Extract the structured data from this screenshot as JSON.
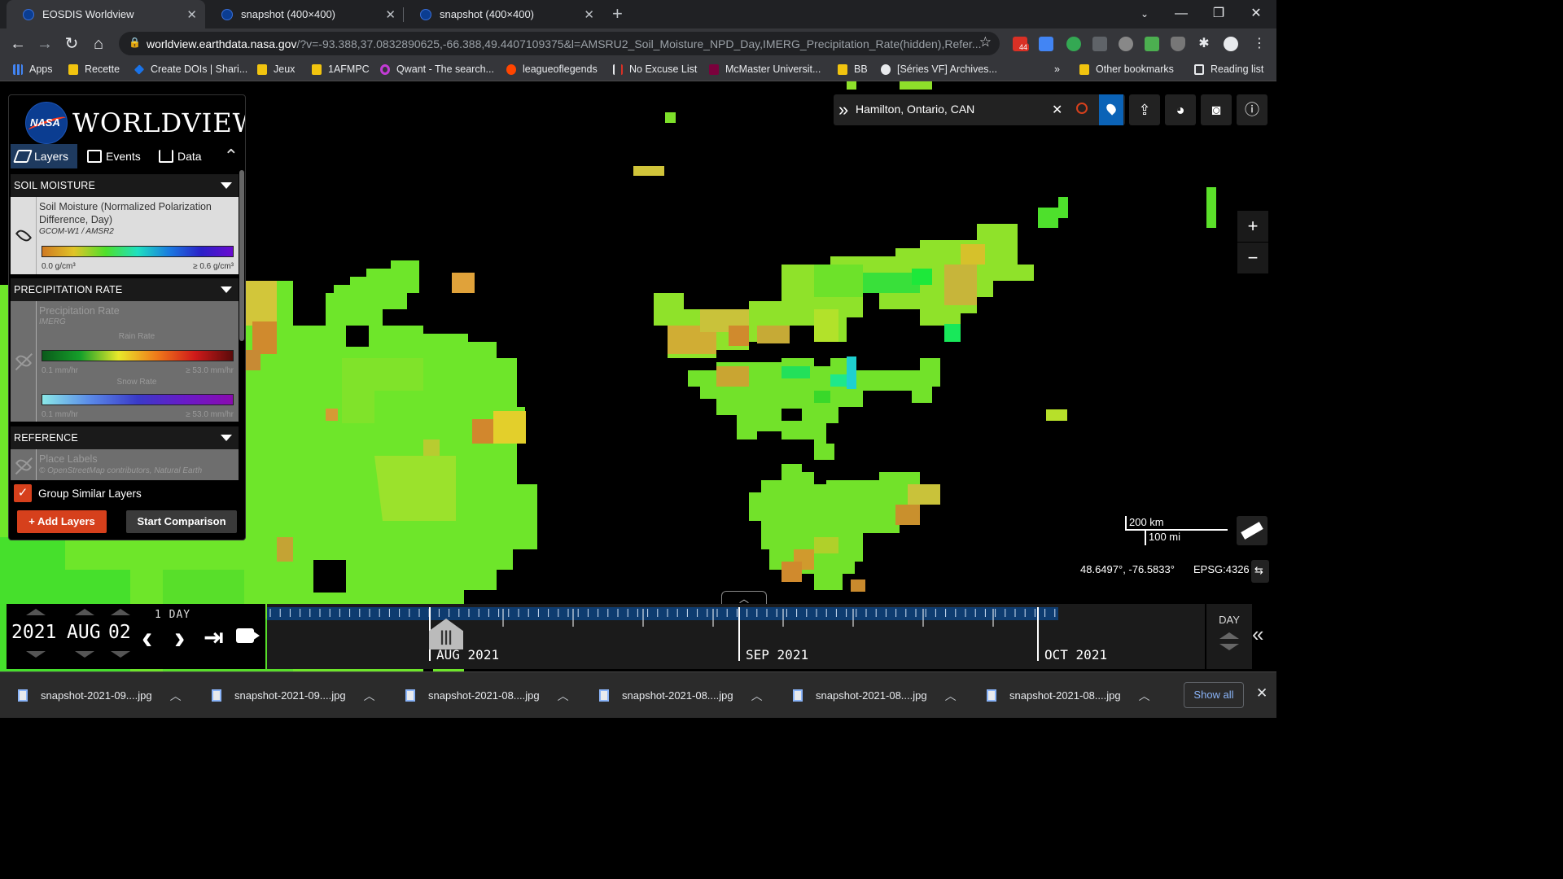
{
  "browser": {
    "tabs": [
      {
        "title": "EOSDIS Worldview",
        "active": true
      },
      {
        "title": "snapshot (400×400)",
        "active": false
      },
      {
        "title": "snapshot (400×400)",
        "active": false
      }
    ],
    "url_host": "worldview.earthdata.nasa.gov",
    "url_rest": "/?v=-93.388,37.0832890625,-66.388,49.4407109375&l=AMSRU2_Soil_Moisture_NPD_Day,IMERG_Precipitation_Rate(hidden),Refer...",
    "ext_badge": "44",
    "bookmarks": [
      {
        "label": "Apps",
        "icon": "apps-grid-icon"
      },
      {
        "label": "Recette",
        "icon": "folder-icon"
      },
      {
        "label": "Create DOIs | Shari...",
        "icon": "doi-icon"
      },
      {
        "label": "Jeux",
        "icon": "folder-icon"
      },
      {
        "label": "1AFMPC",
        "icon": "folder-icon"
      },
      {
        "label": "Qwant - The search...",
        "icon": "qwant-icon"
      },
      {
        "label": "leagueoflegends",
        "icon": "reddit-icon"
      },
      {
        "label": "No Excuse List",
        "icon": "nel-icon"
      },
      {
        "label": "McMaster Universit...",
        "icon": "mcmaster-icon"
      },
      {
        "label": "BB",
        "icon": "folder-icon"
      },
      {
        "label": "[Séries VF] Archives...",
        "icon": "wordpress-icon"
      }
    ],
    "bookmarks_overflow": "»",
    "other_bookmarks": "Other bookmarks",
    "reading_list": "Reading list"
  },
  "worldview": {
    "logo_text": "WORLDVIEW",
    "nasa_text": "NASA",
    "tabs": [
      {
        "label": "Layers",
        "selected": true
      },
      {
        "label": "Events",
        "selected": false
      },
      {
        "label": "Data",
        "selected": false
      }
    ],
    "sections": [
      {
        "heading": "SOIL MOISTURE",
        "layer_title": "Soil Moisture (Normalized Polarization Difference, Day)",
        "layer_sub": "GCOM-W1 / AMSR2",
        "legend_min": "0.0 g/cm³",
        "legend_max": "≥ 0.6 g/cm³",
        "visible": true
      },
      {
        "heading": "PRECIPITATION RATE",
        "layer_title": "Precipitation Rate",
        "layer_sub": "IMERG",
        "rain_label": "Rain Rate",
        "rain_min": "0.1 mm/hr",
        "rain_max": "≥ 53.0 mm/hr",
        "snow_label": "Snow Rate",
        "snow_min": "0.1 mm/hr",
        "snow_max": "≥ 53.0 mm/hr",
        "visible": false
      },
      {
        "heading": "REFERENCE",
        "layer_title": "Place Labels",
        "layer_sub": "© OpenStreetMap contributors, Natural Earth",
        "visible": false
      }
    ],
    "group_similar": {
      "label": "Group Similar Layers",
      "checked": true,
      "check": "✓"
    },
    "add_layers": "+ Add Layers",
    "start_comparison": "Start Comparison",
    "search_location": "Hamilton, Ontario, CAN",
    "scale_km": "200 km",
    "scale_mi": "100 mi",
    "coordinates": "48.6497°, -76.5833°",
    "projection": "EPSG:4326",
    "zoom_in": "+",
    "zoom_out": "−",
    "colors": {
      "accent": "#d6401c",
      "nasa_blue": "#0b3d91",
      "pin_blue": "#0b63b7"
    }
  },
  "timeline": {
    "year": "2021",
    "month": "AUG",
    "day": "02",
    "interval": "1 DAY",
    "zoom_level": "DAY",
    "months": [
      {
        "mon": "AUG",
        "yr": "2021"
      },
      {
        "mon": "SEP",
        "yr": "2021"
      },
      {
        "mon": "OCT",
        "yr": "2021"
      }
    ]
  },
  "downloads": {
    "items": [
      "snapshot-2021-09....jpg",
      "snapshot-2021-09....jpg",
      "snapshot-2021-08....jpg",
      "snapshot-2021-08....jpg",
      "snapshot-2021-08....jpg",
      "snapshot-2021-08....jpg"
    ],
    "show_all": "Show all"
  }
}
